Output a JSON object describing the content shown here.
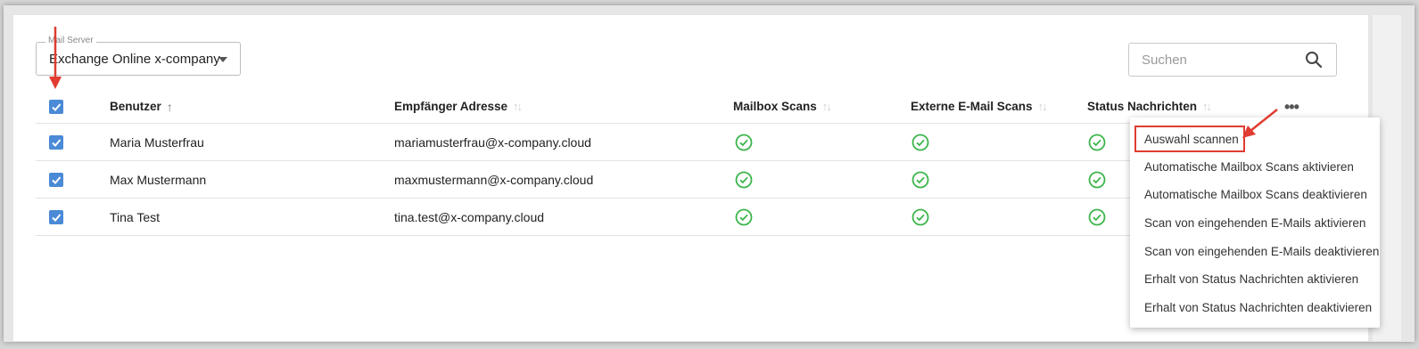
{
  "mail_server": {
    "label": "Mail Server",
    "value": "Exchange Online x-company"
  },
  "search": {
    "placeholder": "Suchen"
  },
  "table": {
    "columns": [
      {
        "label": "Benutzer",
        "sort": "ascending"
      },
      {
        "label": "Empfänger Adresse",
        "sort": "none"
      },
      {
        "label": "Mailbox Scans",
        "sort": "none"
      },
      {
        "label": "Externe E-Mail Scans",
        "sort": "none"
      },
      {
        "label": "Status Nachrichten",
        "sort": "none"
      }
    ],
    "rows": [
      {
        "user": "Maria Musterfrau",
        "address": "mariamusterfrau@x-company.cloud",
        "selected": true,
        "mailbox_scans": true,
        "external_scans": true,
        "status_messages": true
      },
      {
        "user": "Max Mustermann",
        "address": "maxmustermann@x-company.cloud",
        "selected": true,
        "mailbox_scans": true,
        "external_scans": true,
        "status_messages": true
      },
      {
        "user": "Tina Test",
        "address": "tina.test@x-company.cloud",
        "selected": true,
        "mailbox_scans": true,
        "external_scans": true,
        "status_messages": true
      }
    ],
    "select_all": true
  },
  "actions_menu": {
    "trigger": "•••",
    "items": [
      "Auswahl scannen",
      "Automatische Mailbox Scans aktivieren",
      "Automatische Mailbox Scans deaktivieren",
      "Scan von eingehenden E-Mails aktivieren",
      "Scan von eingehenden E-Mails deaktivieren",
      "Erhalt von Status Nachrichten aktivieren",
      "Erhalt von Status Nachrichten deaktivieren"
    ],
    "highlighted_item": "Auswahl scannen"
  },
  "colors": {
    "checkbox": "#4a8ad6",
    "status_ok": "#3cb54a",
    "annotation": "#e03c31"
  }
}
